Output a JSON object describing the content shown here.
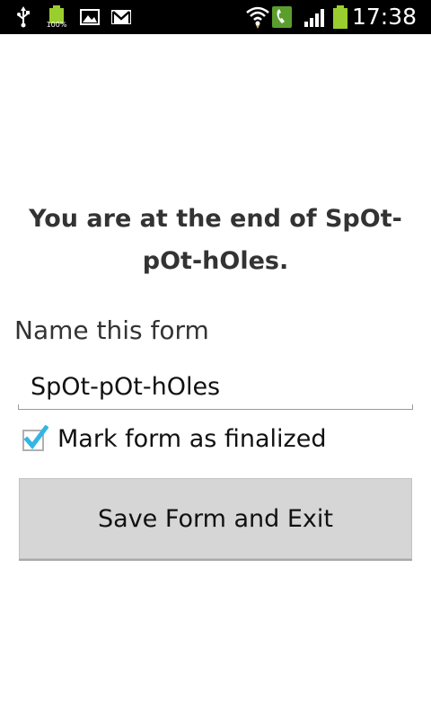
{
  "status_bar": {
    "time": "17:38",
    "battery_level_small": "100%",
    "icons": [
      "usb-icon",
      "battery-full-icon",
      "gallery-icon",
      "gmail-icon",
      "wifi-icon",
      "call-icon",
      "signal-icon",
      "battery-icon"
    ],
    "colors": {
      "background": "#000000",
      "accent": "#9ace2e"
    }
  },
  "form_end": {
    "message": "You are at the end of SpOt-pOt-hOles.",
    "name_label": "Name this form",
    "name_value": "SpOt-pOt-hOles",
    "finalize_label": "Mark form as finalized",
    "finalize_checked": true,
    "save_button_label": "Save Form and Exit"
  },
  "colors": {
    "checkbox_accent": "#33b5e5",
    "button_background": "#d6d6d6"
  }
}
